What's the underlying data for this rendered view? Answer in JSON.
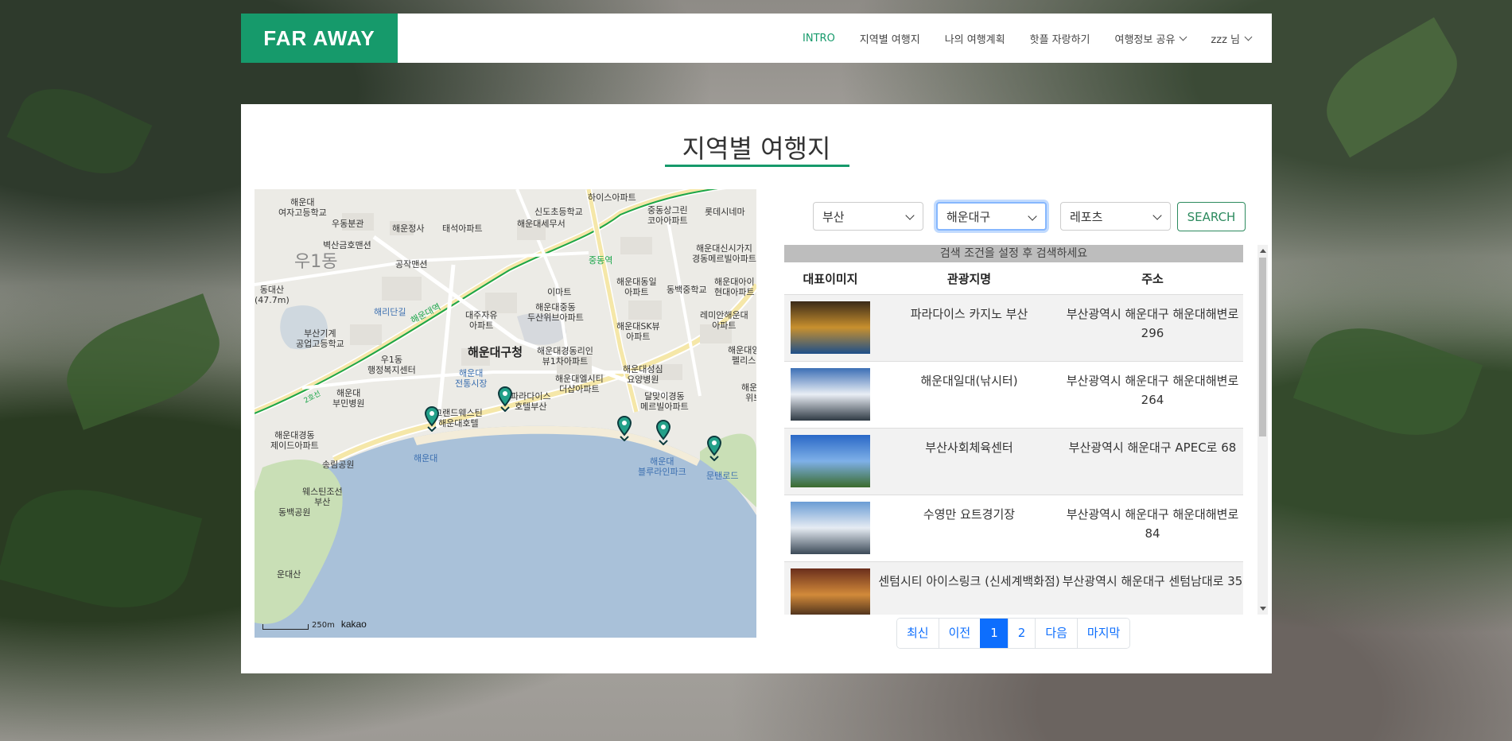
{
  "brand": {
    "name": "FAR AWAY",
    "color": "#169a6b"
  },
  "nav": {
    "items": [
      {
        "label": "INTRO",
        "active": true
      },
      {
        "label": "지역별 여행지"
      },
      {
        "label": "나의 여행계획"
      },
      {
        "label": "핫플 자랑하기"
      },
      {
        "label": "여행정보 공유",
        "dropdown": true
      },
      {
        "label": "zzz 님",
        "dropdown": true
      }
    ]
  },
  "page": {
    "title": "지역별 여행지"
  },
  "map": {
    "labels": {
      "l1": "해운대\n여자고등학교",
      "l2": "우동분관",
      "l3": "해운정사",
      "l4": "태석아파트",
      "l5": "신도초등학교",
      "l6": "해운대세무서",
      "l7": "하이스아파트",
      "l8": "중동상그린\n코아아파트",
      "l9": "롯데시네마",
      "l10": "벽산금호맨션",
      "l11": "공작맨션",
      "l12": "중동역",
      "l13": "해운대신시가지\n경동메르빌아파트",
      "l14": "우1동",
      "l15": "해리단길",
      "l16": "이마트",
      "l17": "해운대동일\n아파트",
      "l18": "동백중학교",
      "l19": "해운대아이\n현대아파트",
      "l20": "부산기계\n공업고등학교",
      "l21": "대주자유\n아파트",
      "l22": "해운대중동\n두산위브아파트",
      "l23": "해운대SK뷰\n아파트",
      "l24": "레미안해운대\n아파트",
      "l25": "우1동\n행정복지센터",
      "l26": "해운대구청",
      "l27": "해운대경동리인\n뷰1차아파트",
      "l28": "해운대성심\n요양병원",
      "l29": "해운대엘시티\n더샵아파트",
      "l30": "해운대\n전통시장",
      "l31": "달맞이경동\n메르빌아파트",
      "l32": "해운대\n부민병원",
      "l33": "파라다이스\n호텔부산",
      "l34": "그랜드웨스틴\n해운대호텔",
      "l35": "해운대경동\n제이드아파트",
      "l36": "해운대",
      "l37": "송림공원",
      "l38": "해운대\n블루라인파크",
      "l39": "문탠로드",
      "l40": "웨스틴조선\n부산",
      "l41": "동백공원",
      "l42": "운대산",
      "l43": "해운대역",
      "l44": "2호선",
      "l45": "해운대양\n펠리스",
      "l46": "해운대\n위브",
      "l47": "동대산\n(47.7m)"
    },
    "scale_label": "250m",
    "attribution": "kakao"
  },
  "search": {
    "region": "부산",
    "district": "해운대구",
    "category": "레포츠",
    "button_label": "SEARCH"
  },
  "table": {
    "hint": "검색 조건을 설정 후 검색하세요",
    "headers": {
      "image": "대표이미지",
      "name": "관광지명",
      "address": "주소"
    },
    "rows": [
      {
        "name": "파라다이스 카지노 부산",
        "address": "부산광역시 해운대구 해운대해변로 296",
        "thumb_colors": [
          "#3a2a18",
          "#c8902e",
          "#1e4f8a"
        ]
      },
      {
        "name": "해운대일대(낚시터)",
        "address": "부산광역시 해운대구 해운대해변로 264",
        "thumb_colors": [
          "#3c6fb5",
          "#e9eef5",
          "#2f3a44"
        ]
      },
      {
        "name": "부산사회체육센터",
        "address": "부산광역시 해운대구 APEC로 68",
        "thumb_colors": [
          "#2a68c6",
          "#7eb0e8",
          "#3b6b2d"
        ]
      },
      {
        "name": "수영만 요트경기장",
        "address": "부산광역시 해운대구 해운대해변로 84",
        "thumb_colors": [
          "#6a9cd4",
          "#e6ecf3",
          "#3c4a58"
        ]
      },
      {
        "name": "센텀시티 아이스링크 (신세계백화점)",
        "address": "부산광역시 해운대구 센텀남대로 35",
        "thumb_colors": [
          "#6a2e1c",
          "#d28a3a",
          "#2b1a14"
        ]
      }
    ]
  },
  "pagination": {
    "items": [
      {
        "label": "최신"
      },
      {
        "label": "이전"
      },
      {
        "label": "1",
        "active": true
      },
      {
        "label": "2"
      },
      {
        "label": "다음"
      },
      {
        "label": "마지막"
      }
    ]
  }
}
